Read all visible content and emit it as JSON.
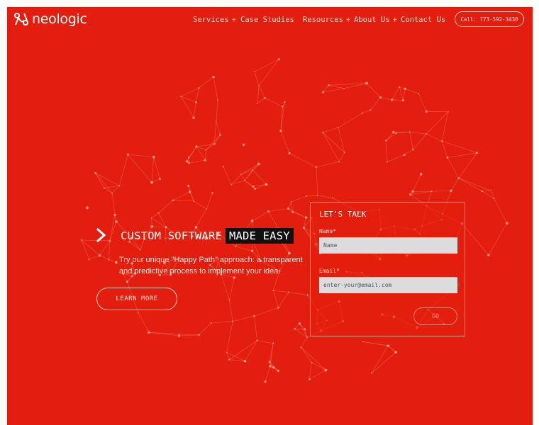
{
  "brand": {
    "name": "neologic",
    "accent": "#e41e0e",
    "highlight_bg": "#111111"
  },
  "nav": {
    "items": [
      {
        "label": "Services",
        "has_submenu": true
      },
      {
        "label": "Case Studies",
        "has_submenu": false
      },
      {
        "label": "Resources",
        "has_submenu": true
      },
      {
        "label": "About Us",
        "has_submenu": true
      },
      {
        "label": "Contact Us",
        "has_submenu": false
      }
    ],
    "submenu_glyph": "+",
    "call_label": "Call: 773-592-3430"
  },
  "hero": {
    "title_plain": "CUSTOM SOFTWARE",
    "title_highlight": "MADE EASY",
    "description": "Try our unique \"Happy Path\" approach: a transparent and predictive process to implement your idea.",
    "cta_label": "LEARN MORE",
    "chevron_icon": "chevron-right-icon"
  },
  "form": {
    "title": "LET'S TALK",
    "name_label": "Name*",
    "name_placeholder": "Name",
    "email_label": "Email*",
    "email_placeholder": "enter-your@email.com",
    "submit_label": "GO"
  }
}
